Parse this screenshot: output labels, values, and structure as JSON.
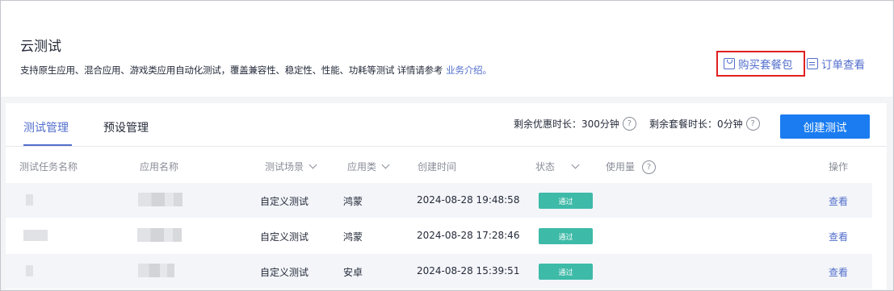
{
  "header": {
    "title": "云测试",
    "description": "支持原生应用、混合应用、游戏类应用自动化测试，覆盖兼容性、稳定性、性能、功耗等测试  详情请参考",
    "intro_link": "业务介绍。",
    "buy_package": "购买套餐包",
    "view_orders": "订单查看"
  },
  "tabs": [
    "测试管理",
    "预设管理"
  ],
  "quota": {
    "discount": "剩余优惠时长：300分钟",
    "package": "剩余套餐时长：0分钟"
  },
  "create_button": "创建测试",
  "table": {
    "columns": [
      "测试任务名称",
      "应用名称",
      "测试场景",
      "应用类",
      "创建时间",
      "状态",
      "使用量",
      "操作"
    ],
    "rows": [
      {
        "scenario": "自定义测试",
        "app_type": "鸿蒙",
        "created": "2024-08-28 19:48:58",
        "status": "通过",
        "action": "查看"
      },
      {
        "scenario": "自定义测试",
        "app_type": "鸿蒙",
        "created": "2024-08-28 17:28:46",
        "status": "通过",
        "action": "查看"
      },
      {
        "scenario": "自定义测试",
        "app_type": "安卓",
        "created": "2024-08-28 15:39:51",
        "status": "通过",
        "action": "查看"
      }
    ]
  },
  "colors": {
    "accent": "#526ecc",
    "primary_button": "#1a7cf0",
    "status_pass": "#3dbaa8",
    "highlight_border": "#e02020"
  }
}
